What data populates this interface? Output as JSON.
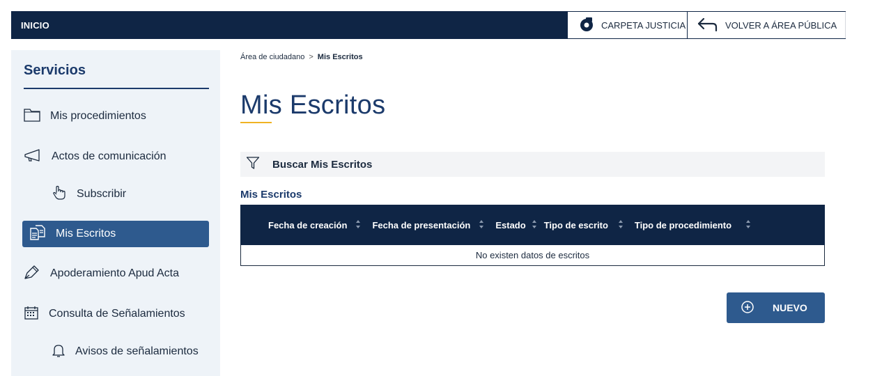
{
  "topbar": {
    "home_label": "INICIO",
    "carpeta_label": "CARPETA JUSTICIA",
    "volver_label": "VOLVER A ÁREA PÚBLICA"
  },
  "sidebar": {
    "title": "Servicios",
    "items": [
      {
        "label": "Mis procedimientos",
        "icon": "folder-icon"
      },
      {
        "label": "Actos de comunicación",
        "icon": "megaphone-icon"
      },
      {
        "label": "Subscribir",
        "icon": "hand-pointer-icon"
      },
      {
        "label": "Mis Escritos",
        "icon": "documents-icon",
        "active": true
      },
      {
        "label": "Apoderamiento Apud Acta",
        "icon": "pen-icon"
      },
      {
        "label": "Consulta de Señalamientos",
        "icon": "calendar-icon"
      },
      {
        "label": "Avisos de señalamientos",
        "icon": "bell-icon"
      }
    ]
  },
  "breadcrumb": {
    "parent": "Área de ciudadano",
    "separator": ">",
    "current": "Mis Escritos"
  },
  "main": {
    "title": "Mis Escritos",
    "search_label": "Buscar Mis Escritos",
    "section_label": "Mis Escritos",
    "table": {
      "columns": [
        "Fecha de creación",
        "Fecha de presentación",
        "Estado",
        "Tipo de escrito",
        "Tipo de procedimiento"
      ],
      "empty_message": "No existen datos de escritos"
    },
    "new_button_label": "NUEVO"
  },
  "colors": {
    "navy": "#0f2545",
    "accent_blue": "#2e5a8e",
    "title_blue": "#1b3a6b",
    "underline_gold": "#f0b323",
    "sidebar_bg": "#eef3f8"
  }
}
